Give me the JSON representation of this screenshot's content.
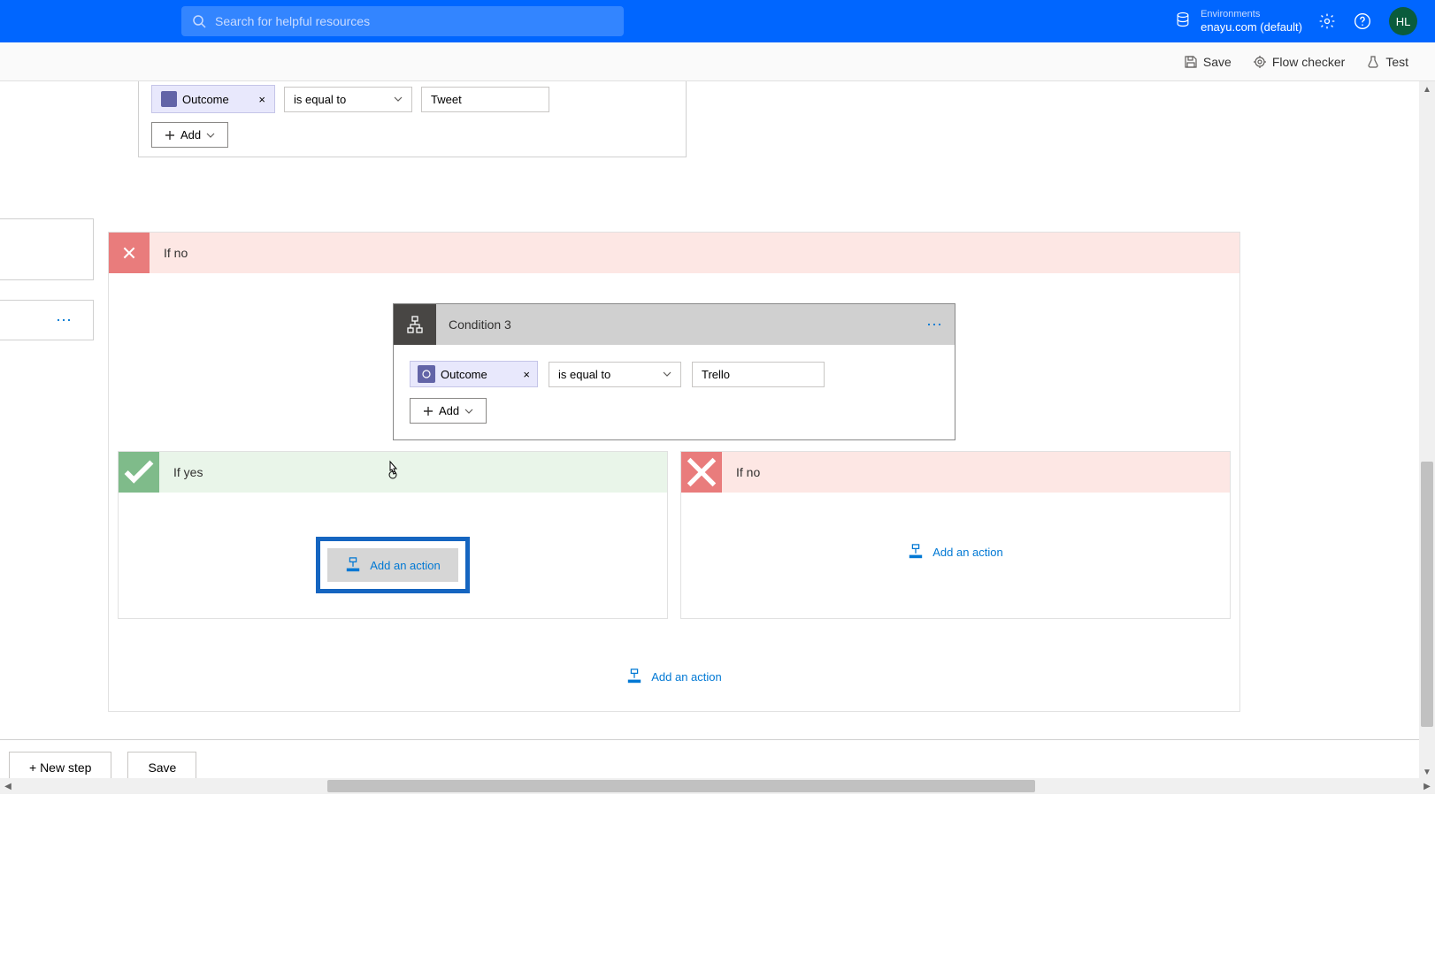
{
  "search": {
    "placeholder": "Search for helpful resources"
  },
  "environment": {
    "label": "Environments",
    "name": "enayu.com (default)"
  },
  "avatar": {
    "initials": "HL"
  },
  "toolbar": {
    "save": "Save",
    "flow_checker": "Flow checker",
    "test": "Test"
  },
  "partial": {
    "token": "Outcome",
    "operator": "is equal to",
    "value": "Tweet",
    "add": "Add"
  },
  "ifno_outer": {
    "title": "If no"
  },
  "condition3": {
    "title": "Condition 3",
    "token": "Outcome",
    "operator": "is equal to",
    "value": "Trello",
    "add": "Add"
  },
  "branches": {
    "yes": {
      "title": "If yes",
      "action": "Add an action"
    },
    "no": {
      "title": "If no",
      "action": "Add an action"
    }
  },
  "mid_action": "Add an action",
  "outer_action": "Add an action",
  "footer": {
    "new_step": "+ New step",
    "save": "Save"
  }
}
